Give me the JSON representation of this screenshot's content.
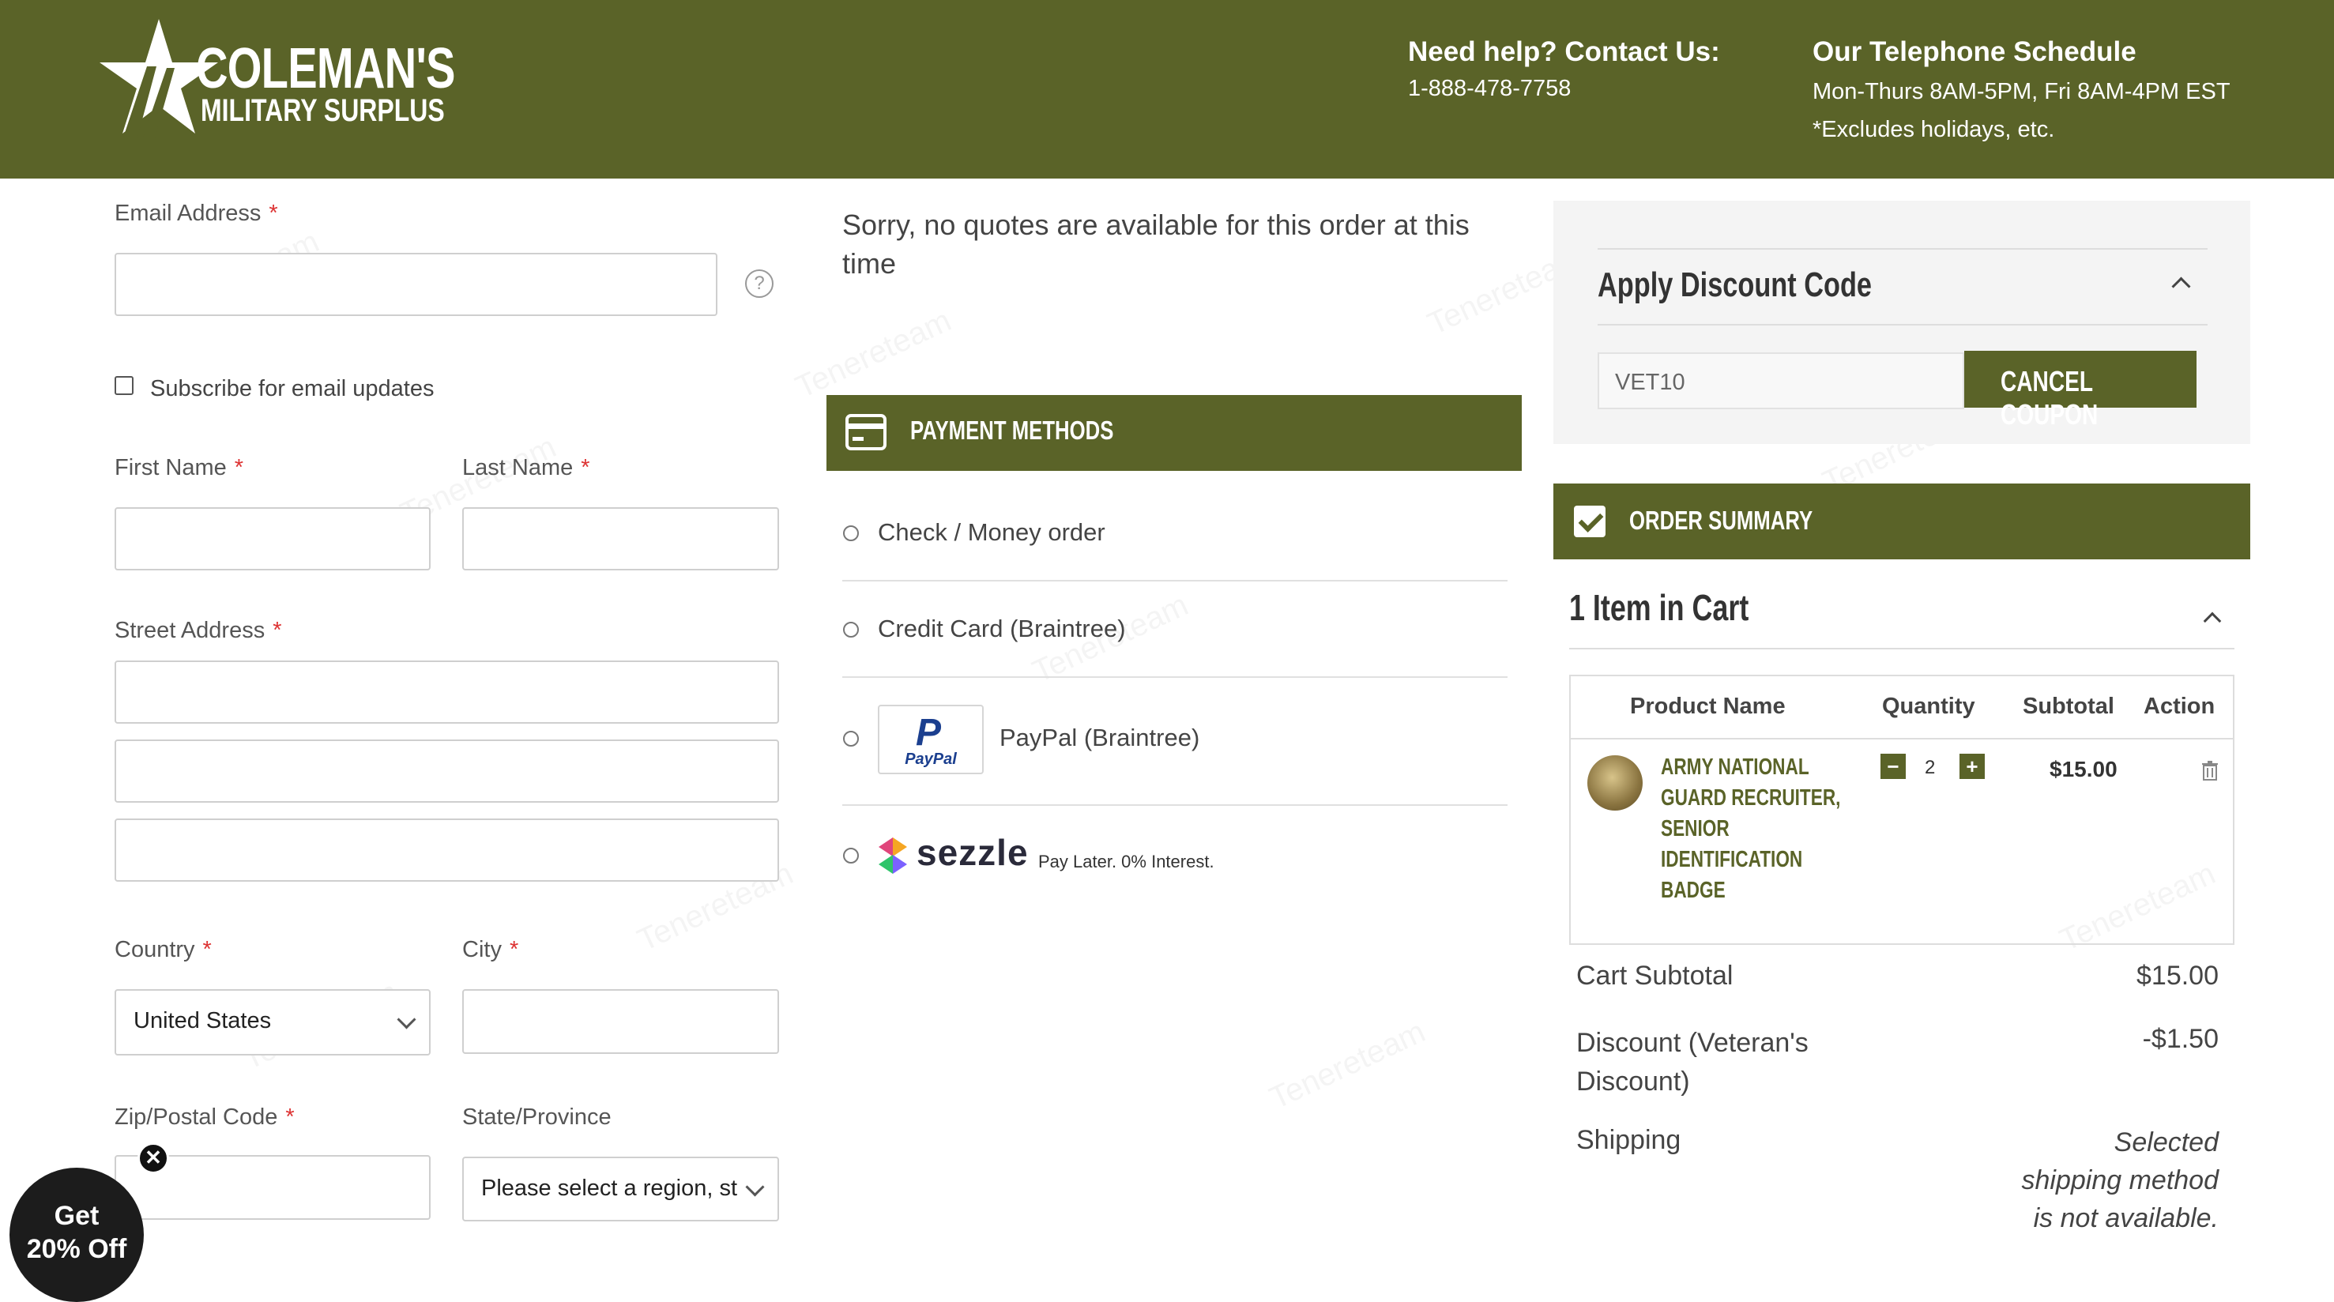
{
  "header": {
    "logo": {
      "line1": "COLEMAN'S",
      "line2": "MILITARY SURPLUS"
    },
    "help": {
      "title": "Need help? Contact Us:",
      "phone": "1-888-478-7758"
    },
    "schedule": {
      "title": "Our Telephone Schedule",
      "hours": "Mon-Thurs 8AM-5PM, Fri 8AM-4PM EST",
      "note": "*Excludes holidays, etc."
    }
  },
  "form": {
    "email_label": "Email Address",
    "email_value": "",
    "subscribe_label": "Subscribe for email updates",
    "first_name_label": "First Name",
    "last_name_label": "Last Name",
    "street_label": "Street Address",
    "country_label": "Country",
    "country_value": "United States",
    "city_label": "City",
    "zip_label": "Zip/Postal Code",
    "state_label": "State/Province",
    "state_value": "Please select a region, st",
    "required_mark": "*"
  },
  "shipping": {
    "message": "Sorry, no quotes are available for this order at this time"
  },
  "payment": {
    "title": "PAYMENT METHODS",
    "methods": [
      {
        "label": "Check / Money order"
      },
      {
        "label": "Credit Card (Braintree)"
      },
      {
        "label": "PayPal (Braintree)"
      },
      {
        "label": "Pay Later. 0% Interest."
      }
    ],
    "paypal_logo_text": "PayPal",
    "sezzle_logo_text": "sezzle"
  },
  "discount": {
    "title": "Apply Discount Code",
    "code_value": "VET10",
    "cancel_label": "CANCEL COUPON"
  },
  "order_summary": {
    "title": "ORDER SUMMARY",
    "items_in_cart": "1 Item in Cart",
    "columns": [
      "Product Name",
      "Quantity",
      "Subtotal",
      "Action"
    ],
    "item": {
      "name_lines": [
        "ARMY NATIONAL",
        "GUARD RECRUITER,",
        "SENIOR",
        "IDENTIFICATION",
        "BADGE"
      ],
      "quantity": "2",
      "subtotal": "$15.00"
    },
    "totals": [
      {
        "label_lines": [
          "Cart Subtotal"
        ],
        "value_lines": [
          "$15.00"
        ]
      },
      {
        "label_lines": [
          "Discount (Veteran's",
          "Discount)"
        ],
        "value_lines": [
          "-$1.50"
        ]
      },
      {
        "label_lines": [
          "Shipping"
        ],
        "value_lines": [
          "Selected",
          "shipping method",
          "is not available."
        ]
      }
    ]
  },
  "promo": {
    "text_line1": "Get",
    "text_line2": "20% Off"
  },
  "watermark_text": "Tenereteam",
  "colors": {
    "brand_green": "#5a6328",
    "required_red": "#dd3333",
    "panel_grey": "#f4f4f4"
  },
  "icons": {
    "card": "credit-card-icon",
    "check": "checkbox-check-icon",
    "trash": "trash-icon",
    "help": "question-icon"
  }
}
